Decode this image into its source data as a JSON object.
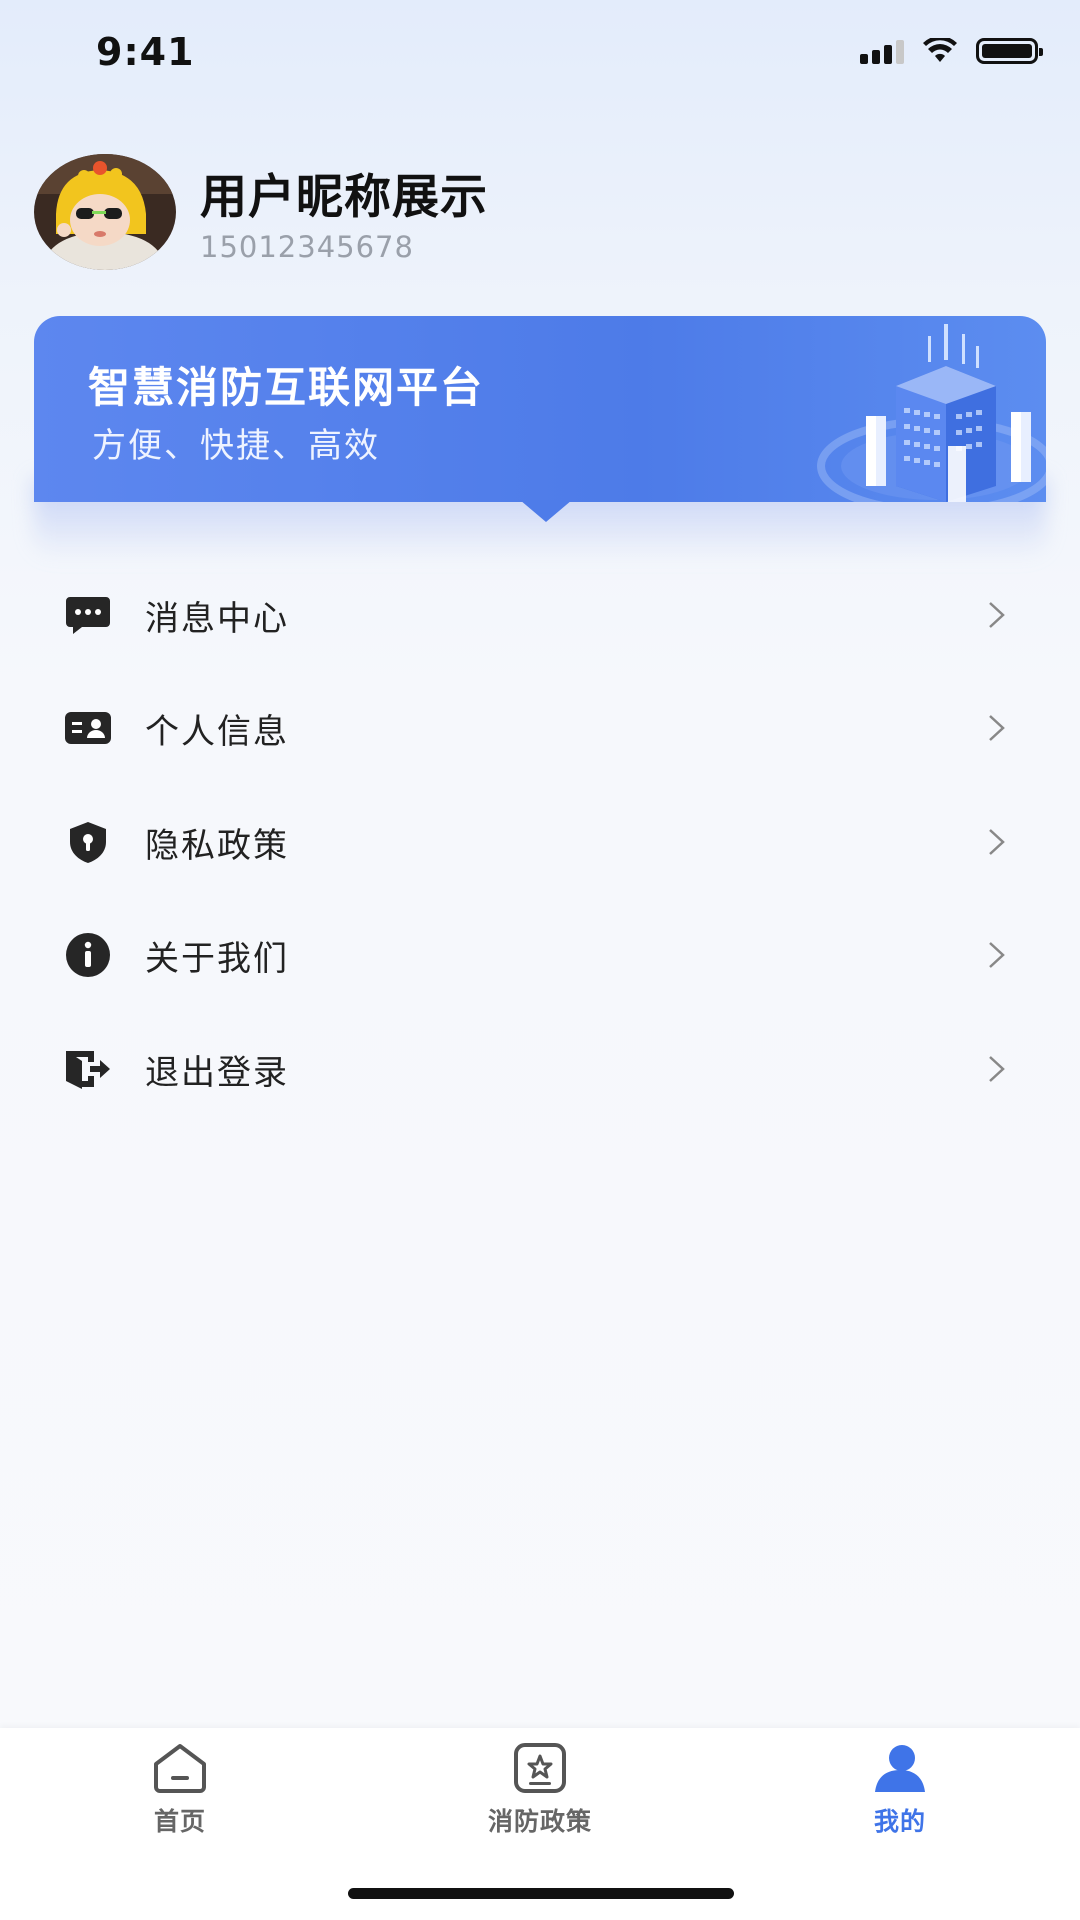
{
  "status_bar": {
    "time": "9:41"
  },
  "profile": {
    "nickname": "用户昵称展示",
    "phone": "15012345678"
  },
  "banner": {
    "title": "智慧消防互联网平台",
    "subtitle": "方便、快捷、高效"
  },
  "menu": [
    {
      "label": "消息中心",
      "icon": "message-icon"
    },
    {
      "label": "个人信息",
      "icon": "id-card-icon"
    },
    {
      "label": "隐私政策",
      "icon": "shield-icon"
    },
    {
      "label": "关于我们",
      "icon": "info-icon"
    },
    {
      "label": "退出登录",
      "icon": "logout-icon"
    }
  ],
  "tabbar": {
    "items": [
      {
        "label": "首页",
        "icon": "home-icon"
      },
      {
        "label": "消防政策",
        "icon": "policy-icon"
      },
      {
        "label": "我的",
        "icon": "user-icon"
      }
    ],
    "active_index": 2
  },
  "colors": {
    "accent": "#3f74e8",
    "banner": "#4d7be8",
    "text": "#222222",
    "muted": "#9aa0aa"
  }
}
